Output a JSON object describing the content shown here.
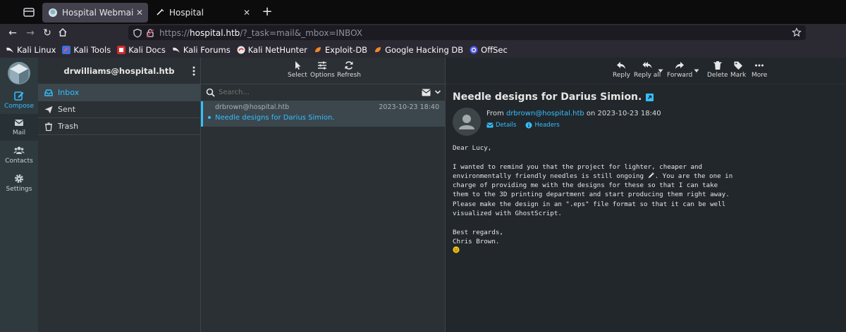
{
  "browser": {
    "tabs": [
      {
        "title": "Hospital Webmail :: Inbox",
        "active": true
      },
      {
        "title": "Hospital",
        "active": false
      }
    ],
    "url": {
      "prefix": "https://",
      "host": "hospital.htb",
      "path": "/?_task=mail&_mbox=INBOX"
    },
    "bookmarks": [
      {
        "label": "Kali Linux",
        "icon": "kali-dragon-icon"
      },
      {
        "label": "Kali Tools",
        "icon": "kali-tools-icon"
      },
      {
        "label": "Kali Docs",
        "icon": "kali-docs-icon"
      },
      {
        "label": "Kali Forums",
        "icon": "kali-dragon-icon"
      },
      {
        "label": "Kali NetHunter",
        "icon": "nethunter-icon"
      },
      {
        "label": "Exploit-DB",
        "icon": "exploit-db-icon"
      },
      {
        "label": "Google Hacking DB",
        "icon": "ghdb-icon"
      },
      {
        "label": "OffSec",
        "icon": "offsec-icon"
      }
    ]
  },
  "rail": {
    "compose": "Compose",
    "mail": "Mail",
    "contacts": "Contacts",
    "settings": "Settings"
  },
  "account": "drwilliams@hospital.htb",
  "folders": [
    {
      "label": "Inbox",
      "icon": "inbox-icon",
      "selected": true
    },
    {
      "label": "Sent",
      "icon": "send-icon",
      "selected": false
    },
    {
      "label": "Trash",
      "icon": "trash-icon",
      "selected": false
    }
  ],
  "list_toolbar": {
    "select": "Select",
    "options": "Options",
    "refresh": "Refresh"
  },
  "search": {
    "placeholder": "Search..."
  },
  "messages": [
    {
      "from": "drbrown@hospital.htb",
      "date": "2023-10-23 18:40",
      "subject": "Needle designs for Darius Simion."
    }
  ],
  "reader_toolbar": {
    "reply": "Reply",
    "reply_all": "Reply all",
    "forward": "Forward",
    "delete": "Delete",
    "mark": "Mark",
    "more": "More"
  },
  "message": {
    "subject": "Needle designs for Darius Simion.",
    "from_prefix": "From",
    "from_address": "drbrown@hospital.htb",
    "date_text": "on 2023-10-23 18:40",
    "details": "Details",
    "headers": "Headers",
    "body": [
      "Dear Lucy,",
      "",
      "I wanted to remind you that the project for lighter, cheaper and",
      "environmentally friendly needles is still ongoing",
      ". You are the one in",
      "charge of providing me with the designs for these so that I can take",
      "them to the 3D printing department and start producing them right away.",
      "Please make the design in an \".eps\" file format so that it can be well",
      "visualized with GhostScript.",
      "",
      "Best regards,",
      "Chris Brown."
    ]
  },
  "colors": {
    "accent": "#37beff",
    "panel": "#2a3033",
    "rail": "#2f3a3f"
  }
}
